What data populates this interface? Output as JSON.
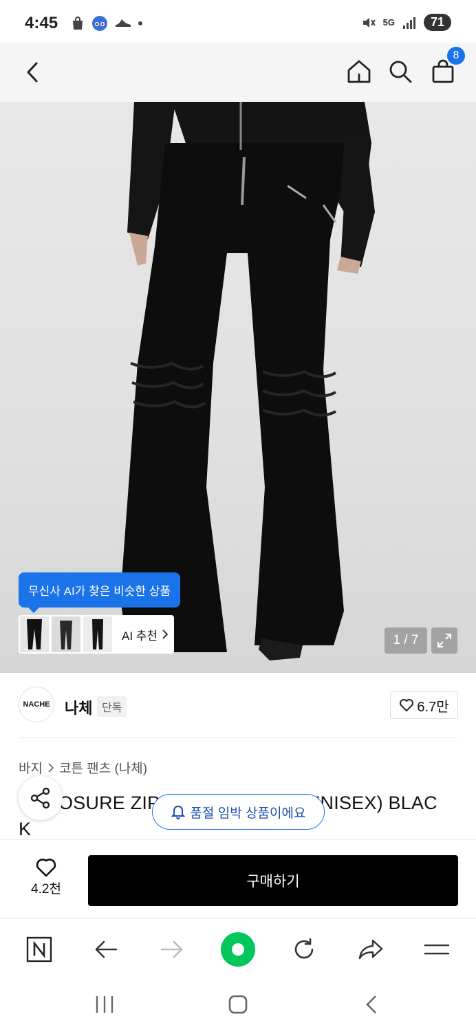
{
  "status_bar": {
    "time": "4:45",
    "network": "5G",
    "battery": "71"
  },
  "header": {
    "cart_count": "8",
    "icons": [
      "back-icon",
      "home-icon",
      "search-icon",
      "bag-icon"
    ]
  },
  "hero": {
    "ai_tooltip": "무신사 AI가 찾은 비슷한 상품",
    "ai_recommend_label": "AI 추천",
    "page_counter": "1 / 7"
  },
  "brand": {
    "logo_text": "NACHE",
    "name": "나체",
    "tag": "단독",
    "likes": "6.7만"
  },
  "breadcrumb": {
    "category": "바지",
    "subcategory": "코튼 팬츠 (나체)"
  },
  "product": {
    "title": "CLOSURE ZIP DETAIL PANTS (UNISEX) BLACK",
    "title_visible": "OSURE ZIP DETAIL PANTS (UNISEX) BLAC",
    "title_line2": "K",
    "restock_notice": "품절 임박 상품이에요"
  },
  "purchase": {
    "wish_count": "4.2천",
    "buy_label": "구매하기"
  },
  "colors": {
    "accent": "#1a73e8",
    "buy_button": "#000000",
    "naver_green": "#03c75a"
  }
}
